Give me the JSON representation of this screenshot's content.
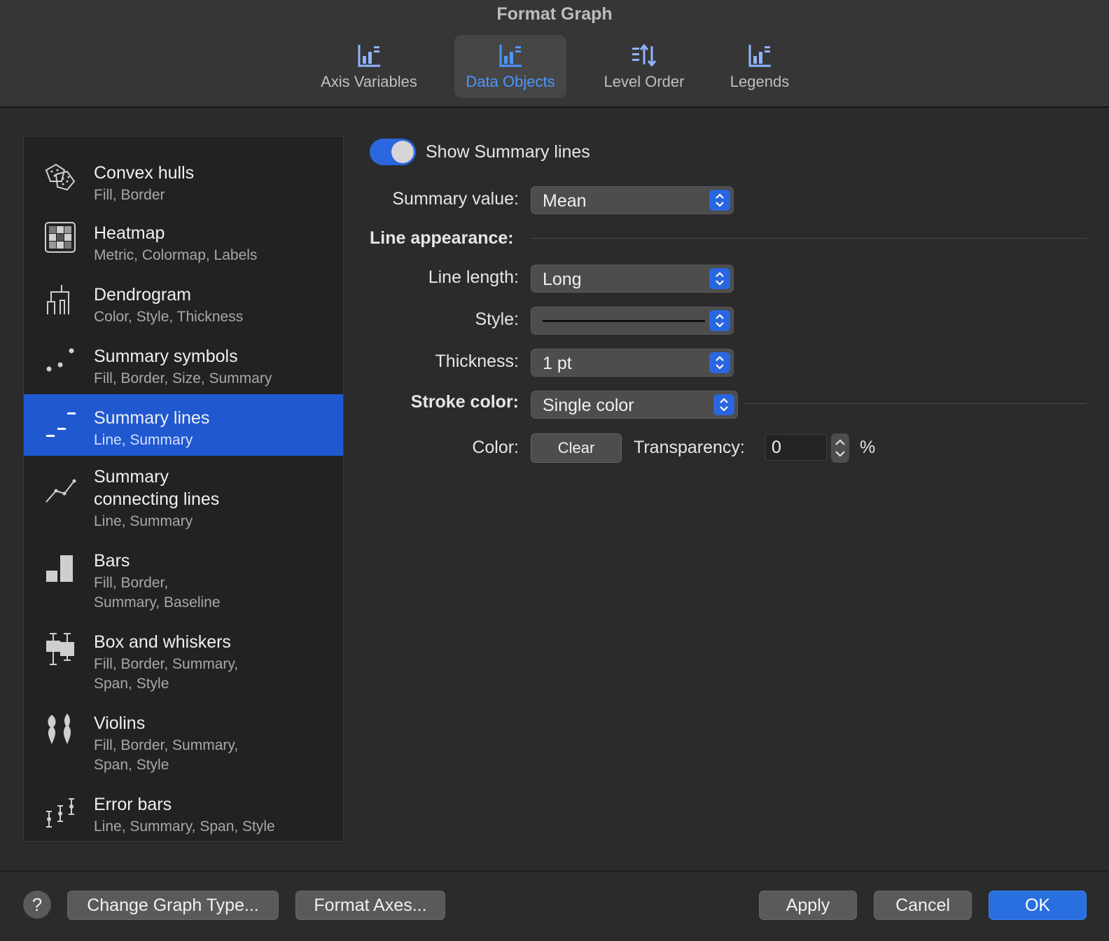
{
  "window": {
    "title": "Format Graph"
  },
  "tabs": [
    {
      "label": "Axis Variables",
      "icon": "axis-variables-icon",
      "active": false
    },
    {
      "label": "Data Objects",
      "icon": "data-objects-icon",
      "active": true
    },
    {
      "label": "Level Order",
      "icon": "level-order-icon",
      "active": false
    },
    {
      "label": "Legends",
      "icon": "legends-icon",
      "active": false
    }
  ],
  "sidebar": {
    "items": [
      {
        "title": "Convex hulls",
        "subtitle": "Fill, Border",
        "icon": "convex-hulls-icon"
      },
      {
        "title": "Heatmap",
        "subtitle": "Metric, Colormap, Labels",
        "icon": "heatmap-icon"
      },
      {
        "title": "Dendrogram",
        "subtitle": "Color, Style, Thickness",
        "icon": "dendrogram-icon"
      },
      {
        "title": "Summary symbols",
        "subtitle": "Fill, Border, Size, Summary",
        "icon": "summary-symbols-icon"
      },
      {
        "title": "Summary lines",
        "subtitle": "Line, Summary",
        "icon": "summary-lines-icon",
        "selected": true
      },
      {
        "title_l1": "Summary",
        "title_l2": "connecting lines",
        "subtitle": "Line, Summary",
        "icon": "summary-connecting-lines-icon"
      },
      {
        "title": "Bars",
        "subtitle_l1": "Fill, Border,",
        "subtitle_l2": "Summary, Baseline",
        "icon": "bars-icon"
      },
      {
        "title": "Box and whiskers",
        "subtitle_l1": "Fill, Border, Summary,",
        "subtitle_l2": "Span, Style",
        "icon": "box-whiskers-icon"
      },
      {
        "title": "Violins",
        "subtitle_l1": "Fill, Border, Summary,",
        "subtitle_l2": "Span, Style",
        "icon": "violins-icon"
      },
      {
        "title": "Error bars",
        "subtitle": "Line, Summary, Span, Style",
        "icon": "error-bars-icon"
      }
    ]
  },
  "panel": {
    "show_toggle_label": "Show Summary lines",
    "show_toggle_on": true,
    "summary_value_label": "Summary value:",
    "summary_value": "Mean",
    "line_appearance_label": "Line appearance:",
    "line_length_label": "Line length:",
    "line_length": "Long",
    "style_label": "Style:",
    "style_value": "solid",
    "thickness_label": "Thickness:",
    "thickness": "1 pt",
    "stroke_color_label": "Stroke color:",
    "stroke_color": "Single color",
    "color_label": "Color:",
    "color_button": "Clear",
    "transparency_label": "Transparency:",
    "transparency": "0",
    "percent": "%"
  },
  "footer": {
    "help": "?",
    "change_graph_type": "Change Graph Type...",
    "format_axes": "Format Axes...",
    "apply": "Apply",
    "cancel": "Cancel",
    "ok": "OK"
  },
  "colors": {
    "accent": "#2a66df",
    "selection": "#2058d0",
    "tab_active_text": "#4b97ff"
  }
}
